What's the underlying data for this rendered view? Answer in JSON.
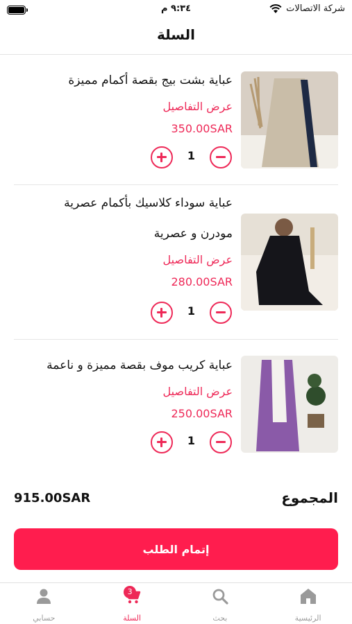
{
  "status_bar": {
    "carrier": "شركة الاتصالات",
    "time": "٩:٣٤ م"
  },
  "header": {
    "title": "السلة"
  },
  "cart": {
    "items": [
      {
        "name_lines": [
          "عباية بشت بيج بقصة أكمام مميزة"
        ],
        "details_label": "عرض التفاصيل",
        "price": "350.00SAR",
        "quantity": "1",
        "image_colors": {
          "background": "#d8cfc4",
          "garment": "#c9bda8",
          "accent": "#1e2a44"
        }
      },
      {
        "name_lines": [
          "عباية سوداء كلاسيك بأكمام عصرية",
          "مودرن و عصرية"
        ],
        "details_label": "عرض التفاصيل",
        "price": "280.00SAR",
        "quantity": "1",
        "image_colors": {
          "background": "#e6e0d6",
          "garment": "#15151a",
          "accent": "#f2ede6"
        }
      },
      {
        "name_lines": [
          "عباية كريب موف بقصة مميزة و ناعمة"
        ],
        "details_label": "عرض التفاصيل",
        "price": "250.00SAR",
        "quantity": "1",
        "image_colors": {
          "background": "#eeece8",
          "garment": "#8a5aa8",
          "accent": "#f4f2ee"
        }
      }
    ],
    "total_label": "المجموع",
    "total_value": "915.00SAR",
    "checkout_label": "إتمام الطلب"
  },
  "tab_bar": {
    "tabs": [
      {
        "label": "الرئيسية",
        "icon": "home-icon"
      },
      {
        "label": "بحث",
        "icon": "search-icon"
      },
      {
        "label": "السلة",
        "icon": "cart-icon",
        "badge": "3",
        "active": true
      },
      {
        "label": "حسابي",
        "icon": "user-icon"
      }
    ]
  },
  "colors": {
    "accent": "#ee2857",
    "checkout_button": "#ff1d4e",
    "inactive_tab": "#9a9a9a"
  }
}
